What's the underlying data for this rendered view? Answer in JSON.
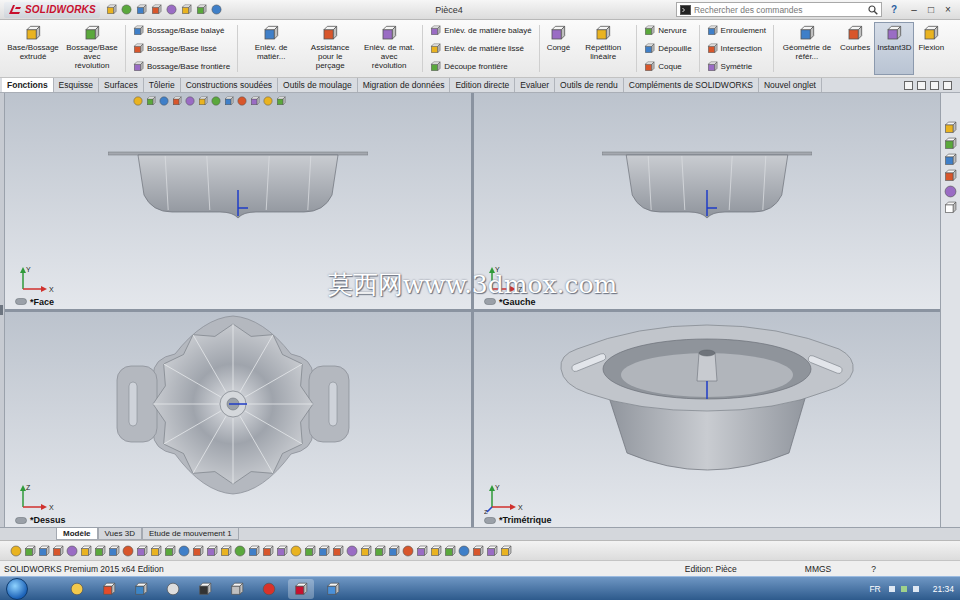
{
  "window": {
    "title": "Pièce4",
    "app": "SOLIDWORKS",
    "help": "?",
    "controls": [
      "–",
      "□",
      "×"
    ]
  },
  "search": {
    "placeholder": "Rechercher des commandes"
  },
  "ribbon": {
    "groups": [
      {
        "kind": "large",
        "items": [
          {
            "label": "Base/Bossage extrudé",
            "selected": false
          },
          {
            "label": "Bossage/Base avec révolution",
            "selected": false
          }
        ]
      },
      {
        "kind": "stack",
        "items": [
          {
            "label": "Bossage/Base balayé",
            "selected": false
          },
          {
            "label": "Bossage/Base lissé",
            "selected": false
          },
          {
            "label": "Bossage/Base frontière",
            "selected": false
          }
        ]
      },
      {
        "kind": "large",
        "items": [
          {
            "label": "Enlèv. de matièr...",
            "selected": false
          },
          {
            "label": "Assistance pour le perçage",
            "selected": false
          },
          {
            "label": "Enlèv. de mat. avec révolution",
            "selected": false
          }
        ]
      },
      {
        "kind": "stack",
        "items": [
          {
            "label": "Enlèv. de matière balayé",
            "selected": false
          },
          {
            "label": "Enlèv. de matière lissé",
            "selected": false
          },
          {
            "label": "Découpe frontière",
            "selected": false
          }
        ]
      },
      {
        "kind": "large",
        "items": [
          {
            "label": "Congé",
            "selected": false
          },
          {
            "label": "Répétition linéaire",
            "selected": false
          }
        ]
      },
      {
        "kind": "stack",
        "items": [
          {
            "label": "Nervure",
            "selected": false
          },
          {
            "label": "Dépouille",
            "selected": false
          },
          {
            "label": "Coque",
            "selected": false
          }
        ]
      },
      {
        "kind": "stack",
        "items": [
          {
            "label": "Enroulement",
            "selected": false
          },
          {
            "label": "Intersection",
            "selected": false
          },
          {
            "label": "Symétrie",
            "selected": false
          }
        ]
      },
      {
        "kind": "large",
        "items": [
          {
            "label": "Géométrie de référ...",
            "selected": false
          },
          {
            "label": "Courbes",
            "selected": false
          },
          {
            "label": "Instant3D",
            "selected": true
          },
          {
            "label": "Flexion",
            "selected": false
          }
        ]
      }
    ]
  },
  "tabs": [
    {
      "label": "Fonctions",
      "selected": true
    },
    {
      "label": "Esquisse",
      "selected": false
    },
    {
      "label": "Surfaces",
      "selected": false
    },
    {
      "label": "Tôlerie",
      "selected": false
    },
    {
      "label": "Constructions soudées",
      "selected": false
    },
    {
      "label": "Outils de moulage",
      "selected": false
    },
    {
      "label": "Migration de données",
      "selected": false
    },
    {
      "label": "Edition directe",
      "selected": false
    },
    {
      "label": "Evaluer",
      "selected": false
    },
    {
      "label": "Outils de rendu",
      "selected": false
    },
    {
      "label": "Compléments de SOLIDWORKS",
      "selected": false
    },
    {
      "label": "Nouvel onglet",
      "selected": false
    }
  ],
  "viewports": [
    {
      "label": "*Face",
      "kind": "front",
      "axes": [
        "Y",
        "X"
      ]
    },
    {
      "label": "*Gauche",
      "kind": "side",
      "axes": [
        "Y",
        "Z"
      ]
    },
    {
      "label": "*Dessus",
      "kind": "top",
      "axes": [
        "Z",
        "X"
      ]
    },
    {
      "label": "*Trimétrique",
      "kind": "iso",
      "axes": [
        "Y",
        "X",
        "Z"
      ]
    }
  ],
  "watermark": "莫西网www.3dmox.com",
  "bottom_tabs": [
    {
      "label": "Modèle",
      "selected": true
    },
    {
      "label": "Vues 3D",
      "selected": false
    },
    {
      "label": "Etude de mouvement 1",
      "selected": false
    }
  ],
  "status_bar": {
    "product": "SOLIDWORKS Premium 2015 x64 Edition",
    "mode": "Edition: Pièce",
    "units": "MMGS",
    "help": "?"
  },
  "taskbar": {
    "language": "FR",
    "time": "21:34"
  }
}
